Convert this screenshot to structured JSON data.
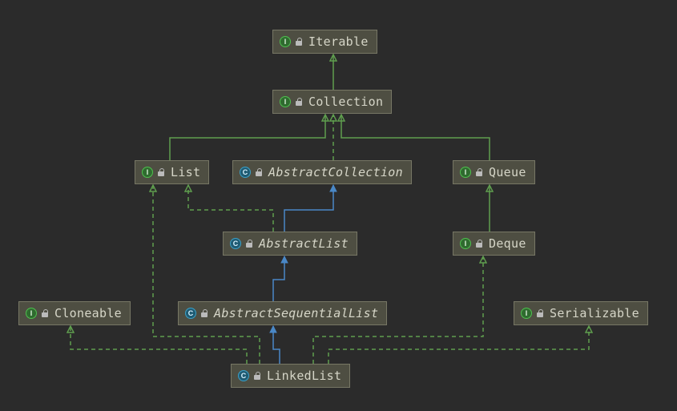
{
  "diagram": {
    "nodes": {
      "iterable": {
        "label": "Iterable",
        "kind": "interface",
        "kind_icon": "I"
      },
      "collection": {
        "label": "Collection",
        "kind": "interface",
        "kind_icon": "I"
      },
      "list": {
        "label": "List",
        "kind": "interface",
        "kind_icon": "I"
      },
      "abscollection": {
        "label": "AbstractCollection",
        "kind": "abstract",
        "kind_icon": "C"
      },
      "queue": {
        "label": "Queue",
        "kind": "interface",
        "kind_icon": "I"
      },
      "abslist": {
        "label": "AbstractList",
        "kind": "abstract",
        "kind_icon": "C"
      },
      "deque": {
        "label": "Deque",
        "kind": "interface",
        "kind_icon": "I"
      },
      "cloneable": {
        "label": "Cloneable",
        "kind": "interface",
        "kind_icon": "I"
      },
      "absseqlist": {
        "label": "AbstractSequentialList",
        "kind": "abstract",
        "kind_icon": "C"
      },
      "serializable": {
        "label": "Serializable",
        "kind": "interface",
        "kind_icon": "I"
      },
      "linkedlist": {
        "label": "LinkedList",
        "kind": "class",
        "kind_icon": "C"
      }
    },
    "edges": [
      {
        "from": "collection",
        "to": "iterable",
        "style": "extends-interface"
      },
      {
        "from": "list",
        "to": "collection",
        "style": "extends-interface"
      },
      {
        "from": "abscollection",
        "to": "collection",
        "style": "implements"
      },
      {
        "from": "queue",
        "to": "collection",
        "style": "extends-interface"
      },
      {
        "from": "abslist",
        "to": "abscollection",
        "style": "extends-class"
      },
      {
        "from": "abslist",
        "to": "list",
        "style": "implements"
      },
      {
        "from": "deque",
        "to": "queue",
        "style": "extends-interface"
      },
      {
        "from": "absseqlist",
        "to": "abslist",
        "style": "extends-class"
      },
      {
        "from": "linkedlist",
        "to": "absseqlist",
        "style": "extends-class"
      },
      {
        "from": "linkedlist",
        "to": "list",
        "style": "implements"
      },
      {
        "from": "linkedlist",
        "to": "deque",
        "style": "implements"
      },
      {
        "from": "linkedlist",
        "to": "cloneable",
        "style": "implements"
      },
      {
        "from": "linkedlist",
        "to": "serializable",
        "style": "implements"
      }
    ],
    "legend": {
      "extends-interface": "solid green arrow (interface extends interface)",
      "extends-class": "solid blue arrow (class extends class)",
      "implements": "dashed green arrow (class implements interface)"
    },
    "colors": {
      "bg": "#2b2b2b",
      "node_bg": "#4e4e42",
      "node_border": "#777765",
      "text": "#d6d6c8",
      "edge_green": "#5f9e4e",
      "edge_blue": "#4a88c7"
    }
  }
}
